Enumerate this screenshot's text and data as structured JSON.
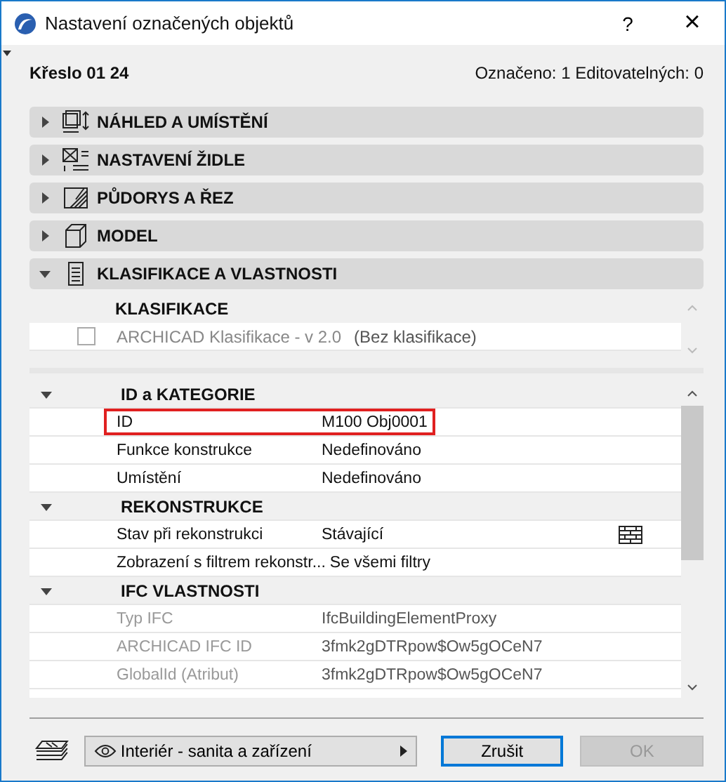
{
  "window": {
    "title": "Nastavení označených objektů",
    "help": "?",
    "close": "×"
  },
  "object_name": "Křeslo 01 24",
  "selection_info": "Označeno: 1 Editovatelných: 0",
  "panels": [
    {
      "kind": "preview",
      "title": "NÁHLED A UMÍSTĚNÍ",
      "expanded": false
    },
    {
      "kind": "params",
      "title": "NASTAVENÍ ŽIDLE",
      "expanded": false
    },
    {
      "kind": "plan",
      "title": "PŮDORYS A ŘEZ",
      "expanded": false
    },
    {
      "kind": "model",
      "title": "MODEL",
      "expanded": false
    },
    {
      "kind": "properties",
      "title": "KLASIFIKACE A VLASTNOSTI",
      "expanded": true
    }
  ],
  "classification": {
    "heading": "KLASIFIKACE",
    "rows": [
      {
        "checked": false,
        "disabled": true,
        "system": "ARCHICAD Klasifikace - v 2.0",
        "value": "(Bez klasifikace)"
      }
    ]
  },
  "property_groups": [
    {
      "title": "ID a KATEGORIE",
      "expanded": true,
      "rows": [
        {
          "kind": "text",
          "label": "ID",
          "value": "M100 Obj0001",
          "disabled": false,
          "highlighted": true
        },
        {
          "kind": "text",
          "label": "Funkce konstrukce",
          "value": "Nedefinováno",
          "disabled": false,
          "highlighted": false
        },
        {
          "kind": "text",
          "label": "Umístění",
          "value": "Nedefinováno",
          "disabled": false,
          "highlighted": false
        }
      ]
    },
    {
      "title": "REKONSTRUKCE",
      "expanded": true,
      "rows": [
        {
          "kind": "brick",
          "label": "Stav při rekonstrukci",
          "value": "Stávající",
          "disabled": false,
          "highlighted": false
        },
        {
          "kind": "text",
          "label": "Zobrazení s filtrem rekonstr...",
          "value": "Se všemi filtry",
          "disabled": false,
          "highlighted": false
        }
      ]
    },
    {
      "title": "IFC VLASTNOSTI",
      "expanded": true,
      "rows": [
        {
          "kind": "text",
          "label": "Typ IFC",
          "value": "IfcBuildingElementProxy",
          "disabled": true,
          "highlighted": false
        },
        {
          "kind": "text",
          "label": "ARCHICAD IFC ID",
          "value": "3fmk2gDTRpow$Ow5gOCeN7",
          "disabled": true,
          "highlighted": false
        },
        {
          "kind": "text",
          "label": "GlobalId (Atribut)",
          "value": "3fmk2gDTRpow$Ow5gOCeN7",
          "disabled": true,
          "highlighted": false
        }
      ]
    }
  ],
  "footer": {
    "layer": "Interiér - sanita a zařízení",
    "cancel": "Zrušit",
    "ok": "OK",
    "ok_disabled": true
  }
}
